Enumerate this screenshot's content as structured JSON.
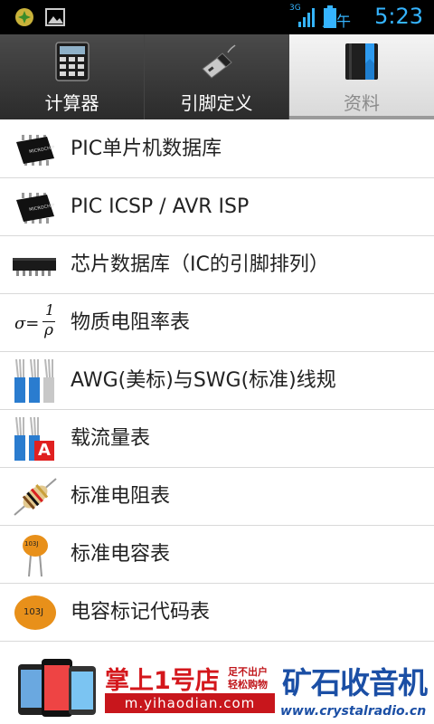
{
  "status": {
    "network": "3G",
    "ampm": "上午",
    "time": "5:23"
  },
  "tabs": [
    {
      "label": "计算器",
      "icon": "calculator-icon"
    },
    {
      "label": "引脚定义",
      "icon": "usb-connector-icon"
    },
    {
      "label": "资料",
      "icon": "book-icon"
    }
  ],
  "list": [
    {
      "label": "PIC单片机数据库",
      "icon": "microchip-ic-icon"
    },
    {
      "label": "PIC ICSP / AVR ISP",
      "icon": "microchip-ic-icon"
    },
    {
      "label": "芯片数据库（IC的引脚排列）",
      "icon": "dip-chip-icon"
    },
    {
      "label": "物质电阻率表",
      "icon": "resistivity-formula-icon",
      "formula_sigma": "σ=",
      "formula_num": "1",
      "formula_den": "ρ"
    },
    {
      "label": "AWG(美标)与SWG(标准)线规",
      "icon": "wires-icon"
    },
    {
      "label": "载流量表",
      "icon": "wires-ampere-icon",
      "badge": "A"
    },
    {
      "label": "标准电阻表",
      "icon": "resistor-icon"
    },
    {
      "label": "标准电容表",
      "icon": "capacitor-icon",
      "cap_code": "103J"
    },
    {
      "label": "电容标记代码表",
      "icon": "capacitor-disc-icon",
      "cap_code": "103J"
    }
  ],
  "ad": {
    "brand": "掌上1号店",
    "slogan1": "足不出户",
    "slogan2": "轻松购物",
    "url": "m.yihaodian.com",
    "site_title": "矿石收音机",
    "site_url": "www.crystalradio.cn"
  }
}
